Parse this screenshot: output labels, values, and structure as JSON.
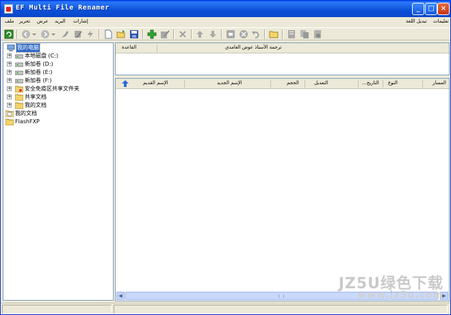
{
  "window": {
    "title": "EF Multi File Renamer"
  },
  "title_buttons": {
    "minimize": "_",
    "maximize": "□",
    "close": "×"
  },
  "menu": {
    "left": [
      "ملف",
      "تحرير",
      "عرض",
      "البريد",
      "إشارات"
    ],
    "right": [
      "تبديل اللغة",
      "تعليمات"
    ]
  },
  "toolbar": {
    "icons": [
      "refresh-icon",
      "back-icon",
      "forward-icon",
      "brush-icon",
      "edit-icon",
      "lightning-icon",
      "new-file-icon",
      "open-icon",
      "save-icon",
      "add-icon",
      "edit-rule-icon",
      "delete-icon",
      "move-up-icon",
      "move-down-icon",
      "stop-icon",
      "cancel-icon",
      "undo-icon",
      "folder-icon",
      "doc-icon",
      "doc-copy-icon",
      "doc-settings-icon"
    ]
  },
  "tree": {
    "items": [
      {
        "label": "我的电脑",
        "icon": "computer-icon",
        "expander": "",
        "selected": true
      },
      {
        "label": "本地磁盘 (C:)",
        "icon": "drive-icon",
        "expander": "+"
      },
      {
        "label": "新加卷 (D:)",
        "icon": "drive-icon",
        "expander": "+"
      },
      {
        "label": "新加卷 (E:)",
        "icon": "drive-icon",
        "expander": "+"
      },
      {
        "label": "新加卷 (F:)",
        "icon": "drive-icon",
        "expander": "+"
      },
      {
        "label": "安全免疫区共享文件夹",
        "icon": "shared-folder-icon",
        "expander": "+"
      },
      {
        "label": "共享文档",
        "icon": "folder-icon",
        "expander": "+"
      },
      {
        "label": "我的文档",
        "icon": "folder-icon",
        "expander": "+"
      },
      {
        "label": "我的文档",
        "icon": "documents-icon",
        "expander": ""
      },
      {
        "label": "FlashFXP",
        "icon": "folder-icon",
        "expander": ""
      }
    ]
  },
  "rules": {
    "columns": [
      "القاعدة",
      "ترجمة الأستاذ عوض الغامدي"
    ]
  },
  "files": {
    "columns": [
      "الإسم القديم",
      "الإسم الجديد",
      "الحجم",
      "التعديل",
      "...التاريخ",
      "النوع",
      "المسار"
    ]
  },
  "watermark": {
    "line1": "JZ5U绿色下载",
    "line2": "www.jz5u.com"
  }
}
